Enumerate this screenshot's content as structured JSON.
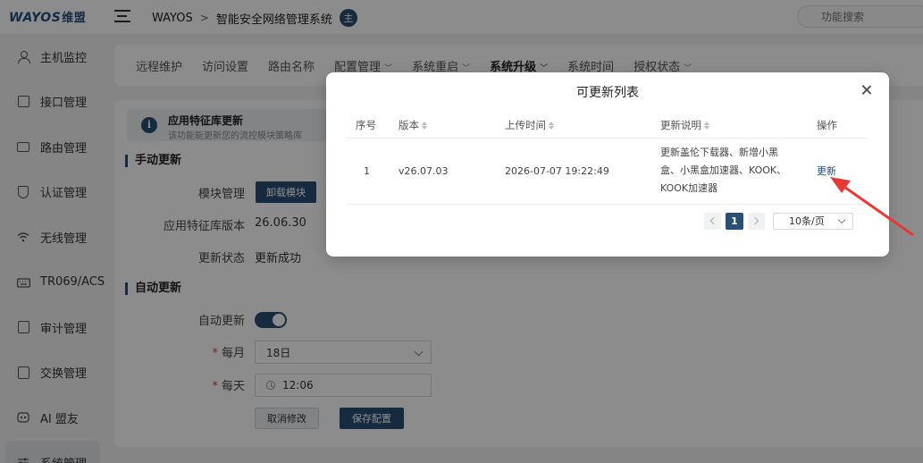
{
  "app": {
    "logo_text": "WAYOS",
    "logo_cn": "维盟",
    "brand_color": "#2b4f76"
  },
  "breadcrumb": {
    "root": "WAYOS",
    "separator": ">",
    "current": "智能安全网络管理系统",
    "badge": "主"
  },
  "search": {
    "placeholder": "功能搜索"
  },
  "sidebar": {
    "items": [
      {
        "label": "主机监控",
        "icon": "user-icon"
      },
      {
        "label": "接口管理",
        "icon": "interface-icon"
      },
      {
        "label": "路由管理",
        "icon": "monitor-icon"
      },
      {
        "label": "认证管理",
        "icon": "shield-icon"
      },
      {
        "label": "无线管理",
        "icon": "wifi-icon"
      },
      {
        "label": "TR069/ACS",
        "icon": "keyboard-icon"
      },
      {
        "label": "审计管理",
        "icon": "audit-icon"
      },
      {
        "label": "交换管理",
        "icon": "switch-icon"
      },
      {
        "label": "AI 盟友",
        "icon": "ai-icon"
      },
      {
        "label": "系统管理",
        "icon": "settings-sliders-icon"
      }
    ]
  },
  "tabs": [
    {
      "label": "远程维护",
      "dropdown": false
    },
    {
      "label": "访问设置",
      "dropdown": false
    },
    {
      "label": "路由名称",
      "dropdown": false
    },
    {
      "label": "配置管理",
      "dropdown": true
    },
    {
      "label": "系统重启",
      "dropdown": true
    },
    {
      "label": "系统升级",
      "dropdown": true
    },
    {
      "label": "系统时间",
      "dropdown": false
    },
    {
      "label": "授权状态",
      "dropdown": true
    }
  ],
  "notice": {
    "icon": "i",
    "title": "应用特征库更新",
    "desc": "该功能能更新您的流控模块策略库"
  },
  "manual": {
    "section_title": "手动更新",
    "module_label": "模块管理",
    "module_button": "卸载模块",
    "version_label": "应用特征库版本",
    "version_value": "26.06.30",
    "status_label": "更新状态",
    "status_value": "更新成功"
  },
  "auto": {
    "section_title": "自动更新",
    "auto_label": "自动更新",
    "monthly_label": "每月",
    "monthly_value": "18日",
    "daily_label": "每天",
    "daily_value": "12:06",
    "required_mark": "*",
    "cancel_button": "取消修改",
    "save_button": "保存配置"
  },
  "modal": {
    "title": "可更新列表",
    "columns": [
      "序号",
      "版本",
      "上传时间",
      "更新说明",
      "操作"
    ],
    "rows": [
      {
        "index": "1",
        "version": "v26.07.03",
        "upload_time": "2026-07-07 19:22:49",
        "description": "更新盖伦下载器、新增小黑盒、小黑盒加速器、KOOK、KOOK加速器",
        "action": "更新"
      }
    ],
    "pagination": {
      "current_page": "1",
      "page_size": "10条/页"
    }
  },
  "annotation": {
    "arrow_color": "#e53935"
  }
}
